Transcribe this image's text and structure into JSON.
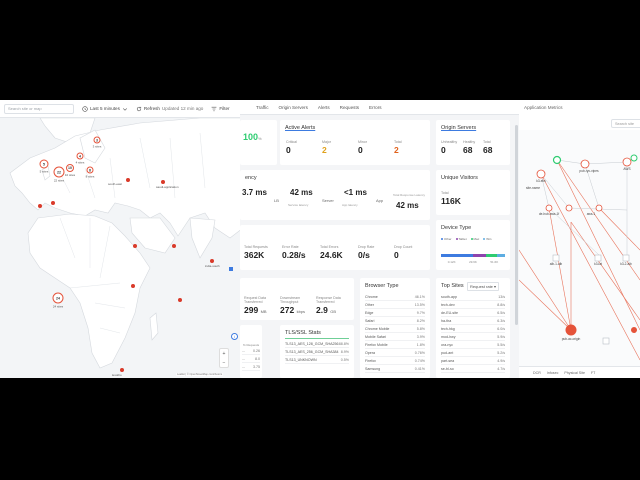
{
  "map": {
    "search_placeholder": "Search site or map",
    "time_range": "Last 5 minutes",
    "refresh_label": "Refresh",
    "updated": "Updated 12 min ago",
    "filter_label": "Filter",
    "clusters": [
      {
        "count": "5",
        "label": "5 sites"
      },
      {
        "count": "22",
        "label": "22 sites"
      },
      {
        "count": "10",
        "label": "10 sites"
      },
      {
        "count": "4",
        "label": "4 sites"
      },
      {
        "count": "8",
        "label": "8 sites"
      },
      {
        "count": "3",
        "label": "3 sites"
      },
      {
        "count": "24",
        "label": "24 sites"
      }
    ],
    "pins": {
      "south_east": "south-east",
      "saudi_app": "saudi-application",
      "india_south": "india-south",
      "africa": "lesotho"
    },
    "zoom_in": "+",
    "zoom_out": "−",
    "attribution": "Leaflet | © OpenStreetMap contributors"
  },
  "dashboard": {
    "tabs": [
      "Traffic",
      "Origin Servers",
      "Alerts",
      "Requests",
      "Errors"
    ],
    "health": {
      "value": "100",
      "unit": "%"
    },
    "active_alerts": {
      "title": "Active Alerts",
      "items": [
        {
          "label": "Critical",
          "value": "0",
          "color": "#222222"
        },
        {
          "label": "Major",
          "value": "2",
          "color": "#e0a11b"
        },
        {
          "label": "Minor",
          "value": "0",
          "color": "#222222"
        },
        {
          "label": "Total",
          "value": "2",
          "color": "#e0611b"
        }
      ]
    },
    "origin_servers": {
      "title": "Origin Servers",
      "items": [
        {
          "label": "Unhealthy",
          "value": "0"
        },
        {
          "label": "Healthy",
          "value": "68"
        },
        {
          "label": "Total",
          "value": "68"
        }
      ]
    },
    "latency": {
      "title": "ency",
      "client": "3.7 ms",
      "lb_label": "LB",
      "lb_value": "42 ms",
      "lb_sub": "Service latency",
      "server_label": "Server",
      "server_value": "<1 ms",
      "server_sub": "App latency",
      "app_label": "App",
      "total_label": "Total Response Latency",
      "total_value": "42 ms"
    },
    "unique_visitors": {
      "title": "Unique Visitors",
      "label": "Total",
      "value": "116K"
    },
    "traffic": [
      {
        "label": "Total Requests",
        "value": "362K"
      },
      {
        "label": "Error Rate",
        "value": "0.28/s"
      },
      {
        "label": "Total Errors",
        "value": "24.6K"
      },
      {
        "label": "Drop Rate",
        "value": "0/s"
      },
      {
        "label": "Drop Count",
        "value": "0"
      }
    ],
    "device_type": {
      "title": "Device Type",
      "legend": [
        "Other",
        "Tablet",
        "Mac",
        "Win"
      ],
      "segments": [
        {
          "name": "Other",
          "percent": 50,
          "color": "#3d7be0"
        },
        {
          "name": "Tablet",
          "percent": 20,
          "color": "#8e44ad"
        },
        {
          "name": "Mac",
          "percent": 18,
          "color": "#2ecc71"
        },
        {
          "name": "Win",
          "percent": 12,
          "color": "#5dade2"
        }
      ],
      "axis": [
        "0.12K",
        "29.6K",
        "51.6K"
      ]
    },
    "throughput": [
      {
        "label": "Request Data Transferred",
        "value": "299",
        "unit": "MB"
      },
      {
        "label": "Downstream Throughput",
        "value": "272",
        "unit": "kbps"
      },
      {
        "label": "Response Data Transferred",
        "value": "2.9",
        "unit": "GB"
      }
    ],
    "browser_type": {
      "title": "Browser Type",
      "rows": [
        {
          "name": "Chrome",
          "value": "46.1%"
        },
        {
          "name": "Other",
          "value": "13.5%"
        },
        {
          "name": "Edge",
          "value": "9.7%"
        },
        {
          "name": "Safari",
          "value": "8.2%"
        },
        {
          "name": "Chrome Mobile",
          "value": "5.8%"
        },
        {
          "name": "Mobile Safari",
          "value": "3.9%"
        },
        {
          "name": "Firefox Mobile",
          "value": "1.8%"
        },
        {
          "name": "Opera",
          "value": "0.76%"
        },
        {
          "name": "Firefox",
          "value": "0.74%"
        },
        {
          "name": "Samsung",
          "value": "0.41%"
        }
      ]
    },
    "top_sites": {
      "title": "Top Sites",
      "metric": "Request rate",
      "rows": [
        {
          "name": "south-app",
          "value": "13/s"
        },
        {
          "name": "tech-dev",
          "value": "8.8/s"
        },
        {
          "name": "de-EU-site",
          "value": "6.5/s"
        },
        {
          "name": "ha-tha",
          "value": "6.3/s"
        },
        {
          "name": "tech-hkg",
          "value": "6.0/s"
        },
        {
          "name": "mod-hwy",
          "value": "5.9/s"
        },
        {
          "name": "ora-nyc",
          "value": "5.5/s"
        },
        {
          "name": "pud-ant",
          "value": "5.2/s"
        },
        {
          "name": "part-sea",
          "value": "4.9/s"
        },
        {
          "name": "se-bl-so",
          "value": "4.7/s"
        }
      ]
    },
    "tls": {
      "title": "TLS/SSL Stats",
      "rows": [
        {
          "name": "TLS13_AES_128_GCM_SHA256",
          "value": "88.8%"
        },
        {
          "name": "TLS13_AES_256_GCM_SHA384",
          "value": "8.9%"
        },
        {
          "name": "TLS13_UNKNOWN",
          "value": "0.5%"
        }
      ]
    },
    "left_list": {
      "header": "% Requests",
      "rows": [
        {
          "name": "...",
          "value": "0.26"
        },
        {
          "name": "...",
          "value": "8.0"
        },
        {
          "name": "...",
          "value": "3.75"
        }
      ]
    }
  },
  "topology": {
    "header": "Application Metrics",
    "search_placeholder": "Search site",
    "nodes": {
      "n1": "k3-eks",
      "n2": "pub-ryc-vipes",
      "n3": "AWS",
      "n4": "site-name",
      "n5": "de-hub-aws-1f",
      "n6": "aws-1",
      "n7": "alb-1-alb",
      "n8": "k3-lat",
      "n9": "k3-2-alb",
      "n10": "pub-ac-origin"
    },
    "footer": [
      "DCR",
      "Infosec",
      "Physical Site",
      "FT"
    ]
  }
}
